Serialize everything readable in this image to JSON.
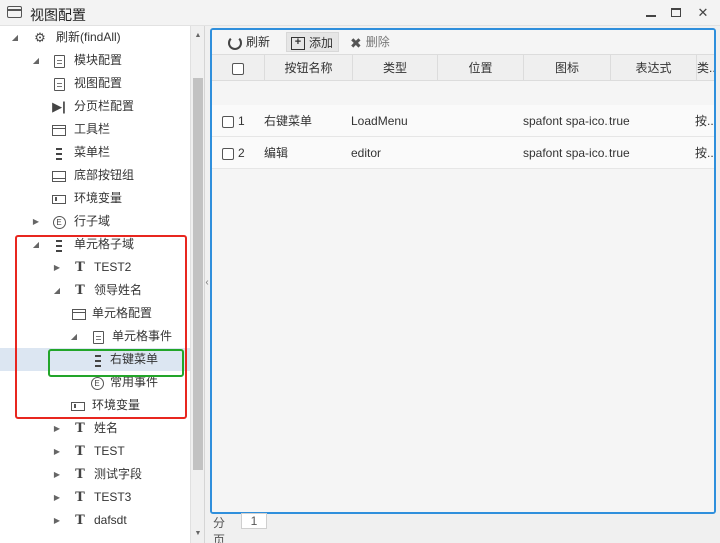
{
  "window": {
    "title": "视图配置"
  },
  "tree": {
    "nodes": [
      {
        "label": "刷新(findAll)",
        "icon": "gear-icon",
        "arrow": "down"
      },
      {
        "label": "模块配置",
        "icon": "page-icon",
        "arrow": "down"
      },
      {
        "label": "视图配置",
        "icon": "page-icon",
        "arrow": ""
      },
      {
        "label": "分页栏配置",
        "icon": "pager-icon",
        "arrow": ""
      },
      {
        "label": "工具栏",
        "icon": "toolbar-icon",
        "arrow": ""
      },
      {
        "label": "菜单栏",
        "icon": "menu-icon",
        "arrow": ""
      },
      {
        "label": "底部按钮组",
        "icon": "bottom-bar-icon",
        "arrow": ""
      },
      {
        "label": "环境变量",
        "icon": "env-icon",
        "arrow": ""
      },
      {
        "label": "行子域",
        "icon": "circle-e-icon",
        "arrow": "right"
      },
      {
        "label": "单元格子域",
        "icon": "menu-icon",
        "arrow": "down"
      },
      {
        "label": "TEST2",
        "icon": "text-icon",
        "arrow": "right"
      },
      {
        "label": "领导姓名",
        "icon": "text-icon",
        "arrow": "down"
      },
      {
        "label": "单元格配置",
        "icon": "toolbar-icon",
        "arrow": ""
      },
      {
        "label": "单元格事件",
        "icon": "page-icon",
        "arrow": "down"
      },
      {
        "label": "右键菜单",
        "icon": "menu-icon",
        "arrow": ""
      },
      {
        "label": "常用事件",
        "icon": "circle-e-icon",
        "arrow": ""
      },
      {
        "label": "环境变量",
        "icon": "env-icon",
        "arrow": ""
      },
      {
        "label": "姓名",
        "icon": "text-icon",
        "arrow": "right"
      },
      {
        "label": "TEST",
        "icon": "text-icon",
        "arrow": "right"
      },
      {
        "label": "测试字段",
        "icon": "text-icon",
        "arrow": "right"
      },
      {
        "label": "TEST3",
        "icon": "text-icon",
        "arrow": "right"
      },
      {
        "label": "dafsdt",
        "icon": "text-icon",
        "arrow": "right"
      }
    ],
    "selected_label": "右键菜单"
  },
  "toolbar": {
    "refresh_label": "刷新",
    "add_label": "添加",
    "delete_label": "删除"
  },
  "table": {
    "columns": [
      "按钮名称",
      "类型",
      "位置",
      "图标",
      "表达式",
      "类..."
    ],
    "rows": [
      {
        "num": "1",
        "name": "右键菜单",
        "type": "LoadMenu",
        "position": "",
        "icon": "spafont spa-ico...",
        "expression": "true",
        "class": "按..."
      },
      {
        "num": "2",
        "name": "编辑",
        "type": "editor",
        "position": "",
        "icon": "spafont spa-ico...",
        "expression": "true",
        "class": "按..."
      }
    ]
  },
  "pagination": {
    "label": "分页",
    "current_page": "1"
  },
  "colors": {
    "highlight_red": "#e8261f",
    "highlight_green": "#22a52a",
    "focus_blue": "#2f8fdc",
    "selected_row": "#dce6f2"
  }
}
